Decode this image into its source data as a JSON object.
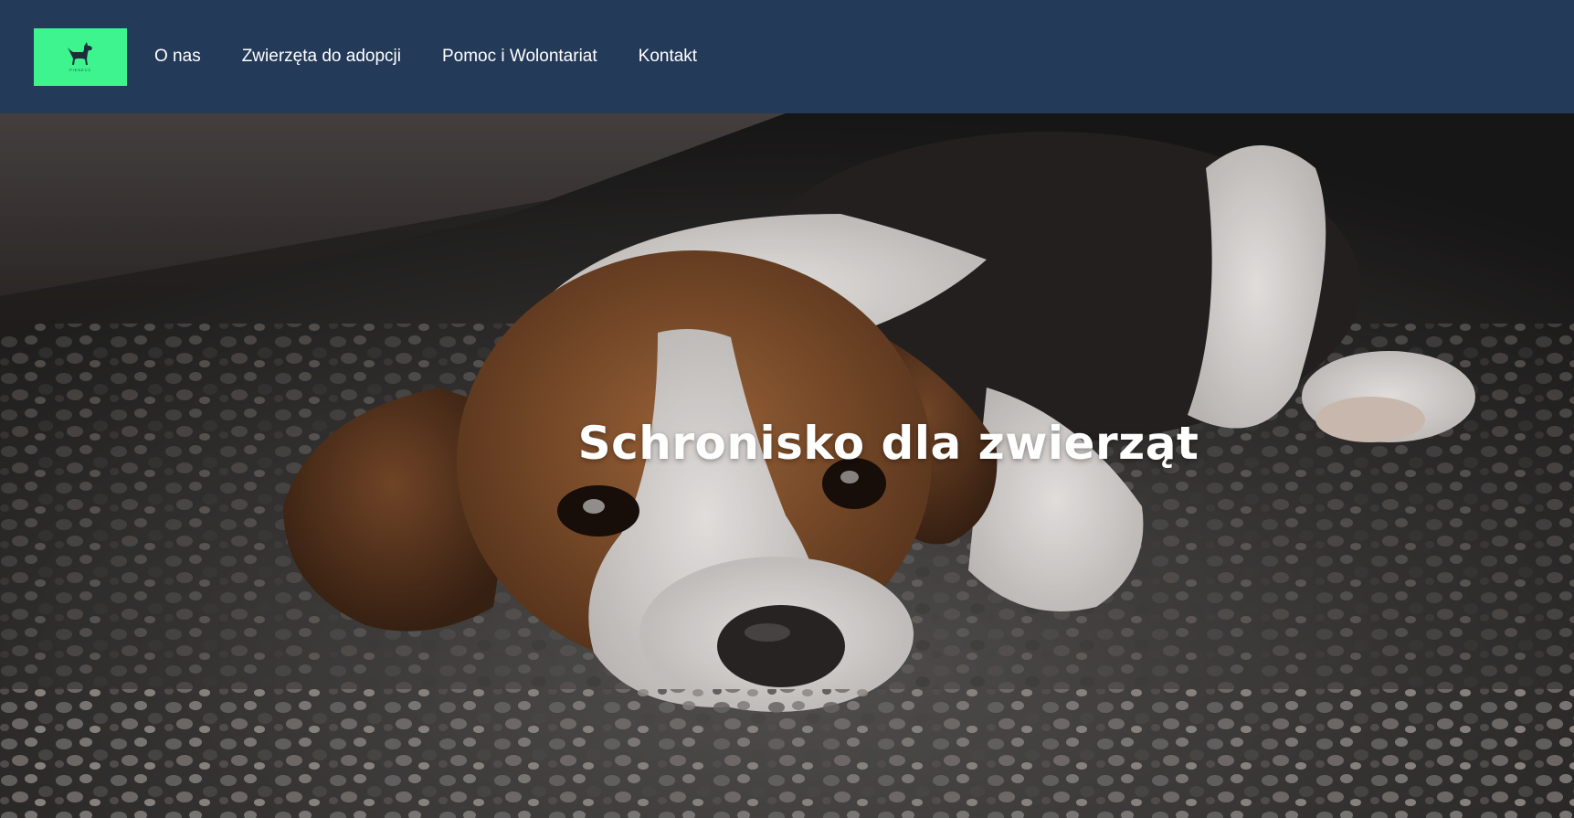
{
  "site": {
    "logo_label": "PIESECZ",
    "logo_icon": "dog-icon",
    "brand_color": "#3ef48f",
    "navbar_color": "#243a59"
  },
  "nav": {
    "items": [
      {
        "label": "O nas"
      },
      {
        "label": "Zwierzęta do adopcji"
      },
      {
        "label": "Pomoc i Wolontariat"
      },
      {
        "label": "Kontakt"
      }
    ]
  },
  "hero": {
    "title": "Schronisko dla zwierząt",
    "image_subject": "beagle-puppy-photo"
  }
}
